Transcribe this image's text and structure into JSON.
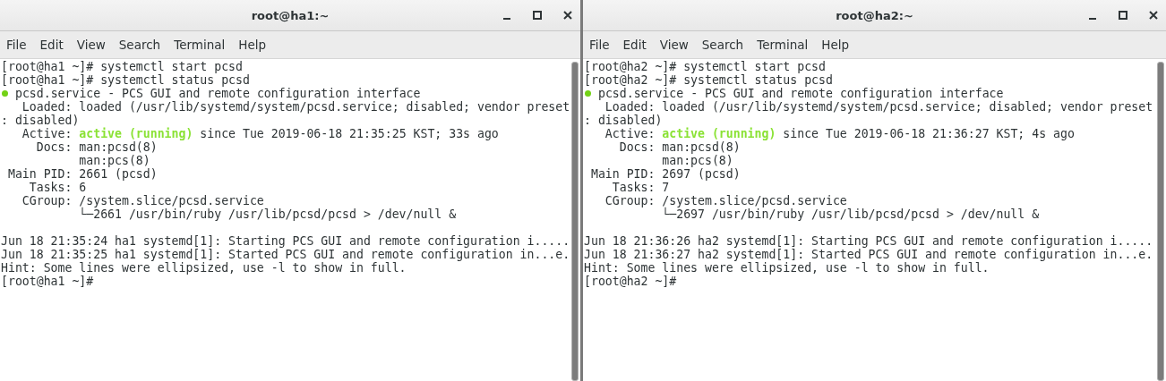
{
  "windows": [
    {
      "title": "root@ha1:~",
      "menu": [
        "File",
        "Edit",
        "View",
        "Search",
        "Terminal",
        "Help"
      ],
      "lines": [
        {
          "kind": "text",
          "text": "[root@ha1 ~]# systemctl start pcsd"
        },
        {
          "kind": "text",
          "text": "[root@ha1 ~]# systemctl status pcsd"
        },
        {
          "kind": "unit",
          "color": "#73d216",
          "text": " pcsd.service - PCS GUI and remote configuration interface"
        },
        {
          "kind": "text",
          "text": "   Loaded: loaded (/usr/lib/systemd/system/pcsd.service; disabled; vendor preset"
        },
        {
          "kind": "text",
          "text": ": disabled)"
        },
        {
          "kind": "active",
          "label": "   Active: ",
          "state": "active (running)",
          "rest": " since Tue 2019-06-18 21:35:25 KST; 33s ago"
        },
        {
          "kind": "text",
          "text": "     Docs: man:pcsd(8)"
        },
        {
          "kind": "text",
          "text": "           man:pcs(8)"
        },
        {
          "kind": "text",
          "text": " Main PID: 2661 (pcsd)"
        },
        {
          "kind": "text",
          "text": "    Tasks: 6"
        },
        {
          "kind": "text",
          "text": "   CGroup: /system.slice/pcsd.service"
        },
        {
          "kind": "text",
          "text": "           └─2661 /usr/bin/ruby /usr/lib/pcsd/pcsd > /dev/null &"
        },
        {
          "kind": "blank"
        },
        {
          "kind": "text",
          "text": "Jun 18 21:35:24 ha1 systemd[1]: Starting PCS GUI and remote configuration i....."
        },
        {
          "kind": "text",
          "text": "Jun 18 21:35:25 ha1 systemd[1]: Started PCS GUI and remote configuration in...e."
        },
        {
          "kind": "text",
          "text": "Hint: Some lines were ellipsized, use -l to show in full."
        },
        {
          "kind": "text",
          "text": "[root@ha1 ~]#"
        }
      ]
    },
    {
      "title": "root@ha2:~",
      "menu": [
        "File",
        "Edit",
        "View",
        "Search",
        "Terminal",
        "Help"
      ],
      "lines": [
        {
          "kind": "text",
          "text": "[root@ha2 ~]# systemctl start pcsd"
        },
        {
          "kind": "text",
          "text": "[root@ha2 ~]# systemctl status pcsd"
        },
        {
          "kind": "unit",
          "color": "#73d216",
          "text": " pcsd.service - PCS GUI and remote configuration interface"
        },
        {
          "kind": "text",
          "text": "   Loaded: loaded (/usr/lib/systemd/system/pcsd.service; disabled; vendor preset"
        },
        {
          "kind": "text",
          "text": ": disabled)"
        },
        {
          "kind": "active",
          "label": "   Active: ",
          "state": "active (running)",
          "rest": " since Tue 2019-06-18 21:36:27 KST; 4s ago"
        },
        {
          "kind": "text",
          "text": "     Docs: man:pcsd(8)"
        },
        {
          "kind": "text",
          "text": "           man:pcs(8)"
        },
        {
          "kind": "text",
          "text": " Main PID: 2697 (pcsd)"
        },
        {
          "kind": "text",
          "text": "    Tasks: 7"
        },
        {
          "kind": "text",
          "text": "   CGroup: /system.slice/pcsd.service"
        },
        {
          "kind": "text",
          "text": "           └─2697 /usr/bin/ruby /usr/lib/pcsd/pcsd > /dev/null &"
        },
        {
          "kind": "blank"
        },
        {
          "kind": "text",
          "text": "Jun 18 21:36:26 ha2 systemd[1]: Starting PCS GUI and remote configuration i....."
        },
        {
          "kind": "text",
          "text": "Jun 18 21:36:27 ha2 systemd[1]: Started PCS GUI and remote configuration in...e."
        },
        {
          "kind": "text",
          "text": "Hint: Some lines were ellipsized, use -l to show in full."
        },
        {
          "kind": "text",
          "text": "[root@ha2 ~]#"
        }
      ]
    }
  ]
}
